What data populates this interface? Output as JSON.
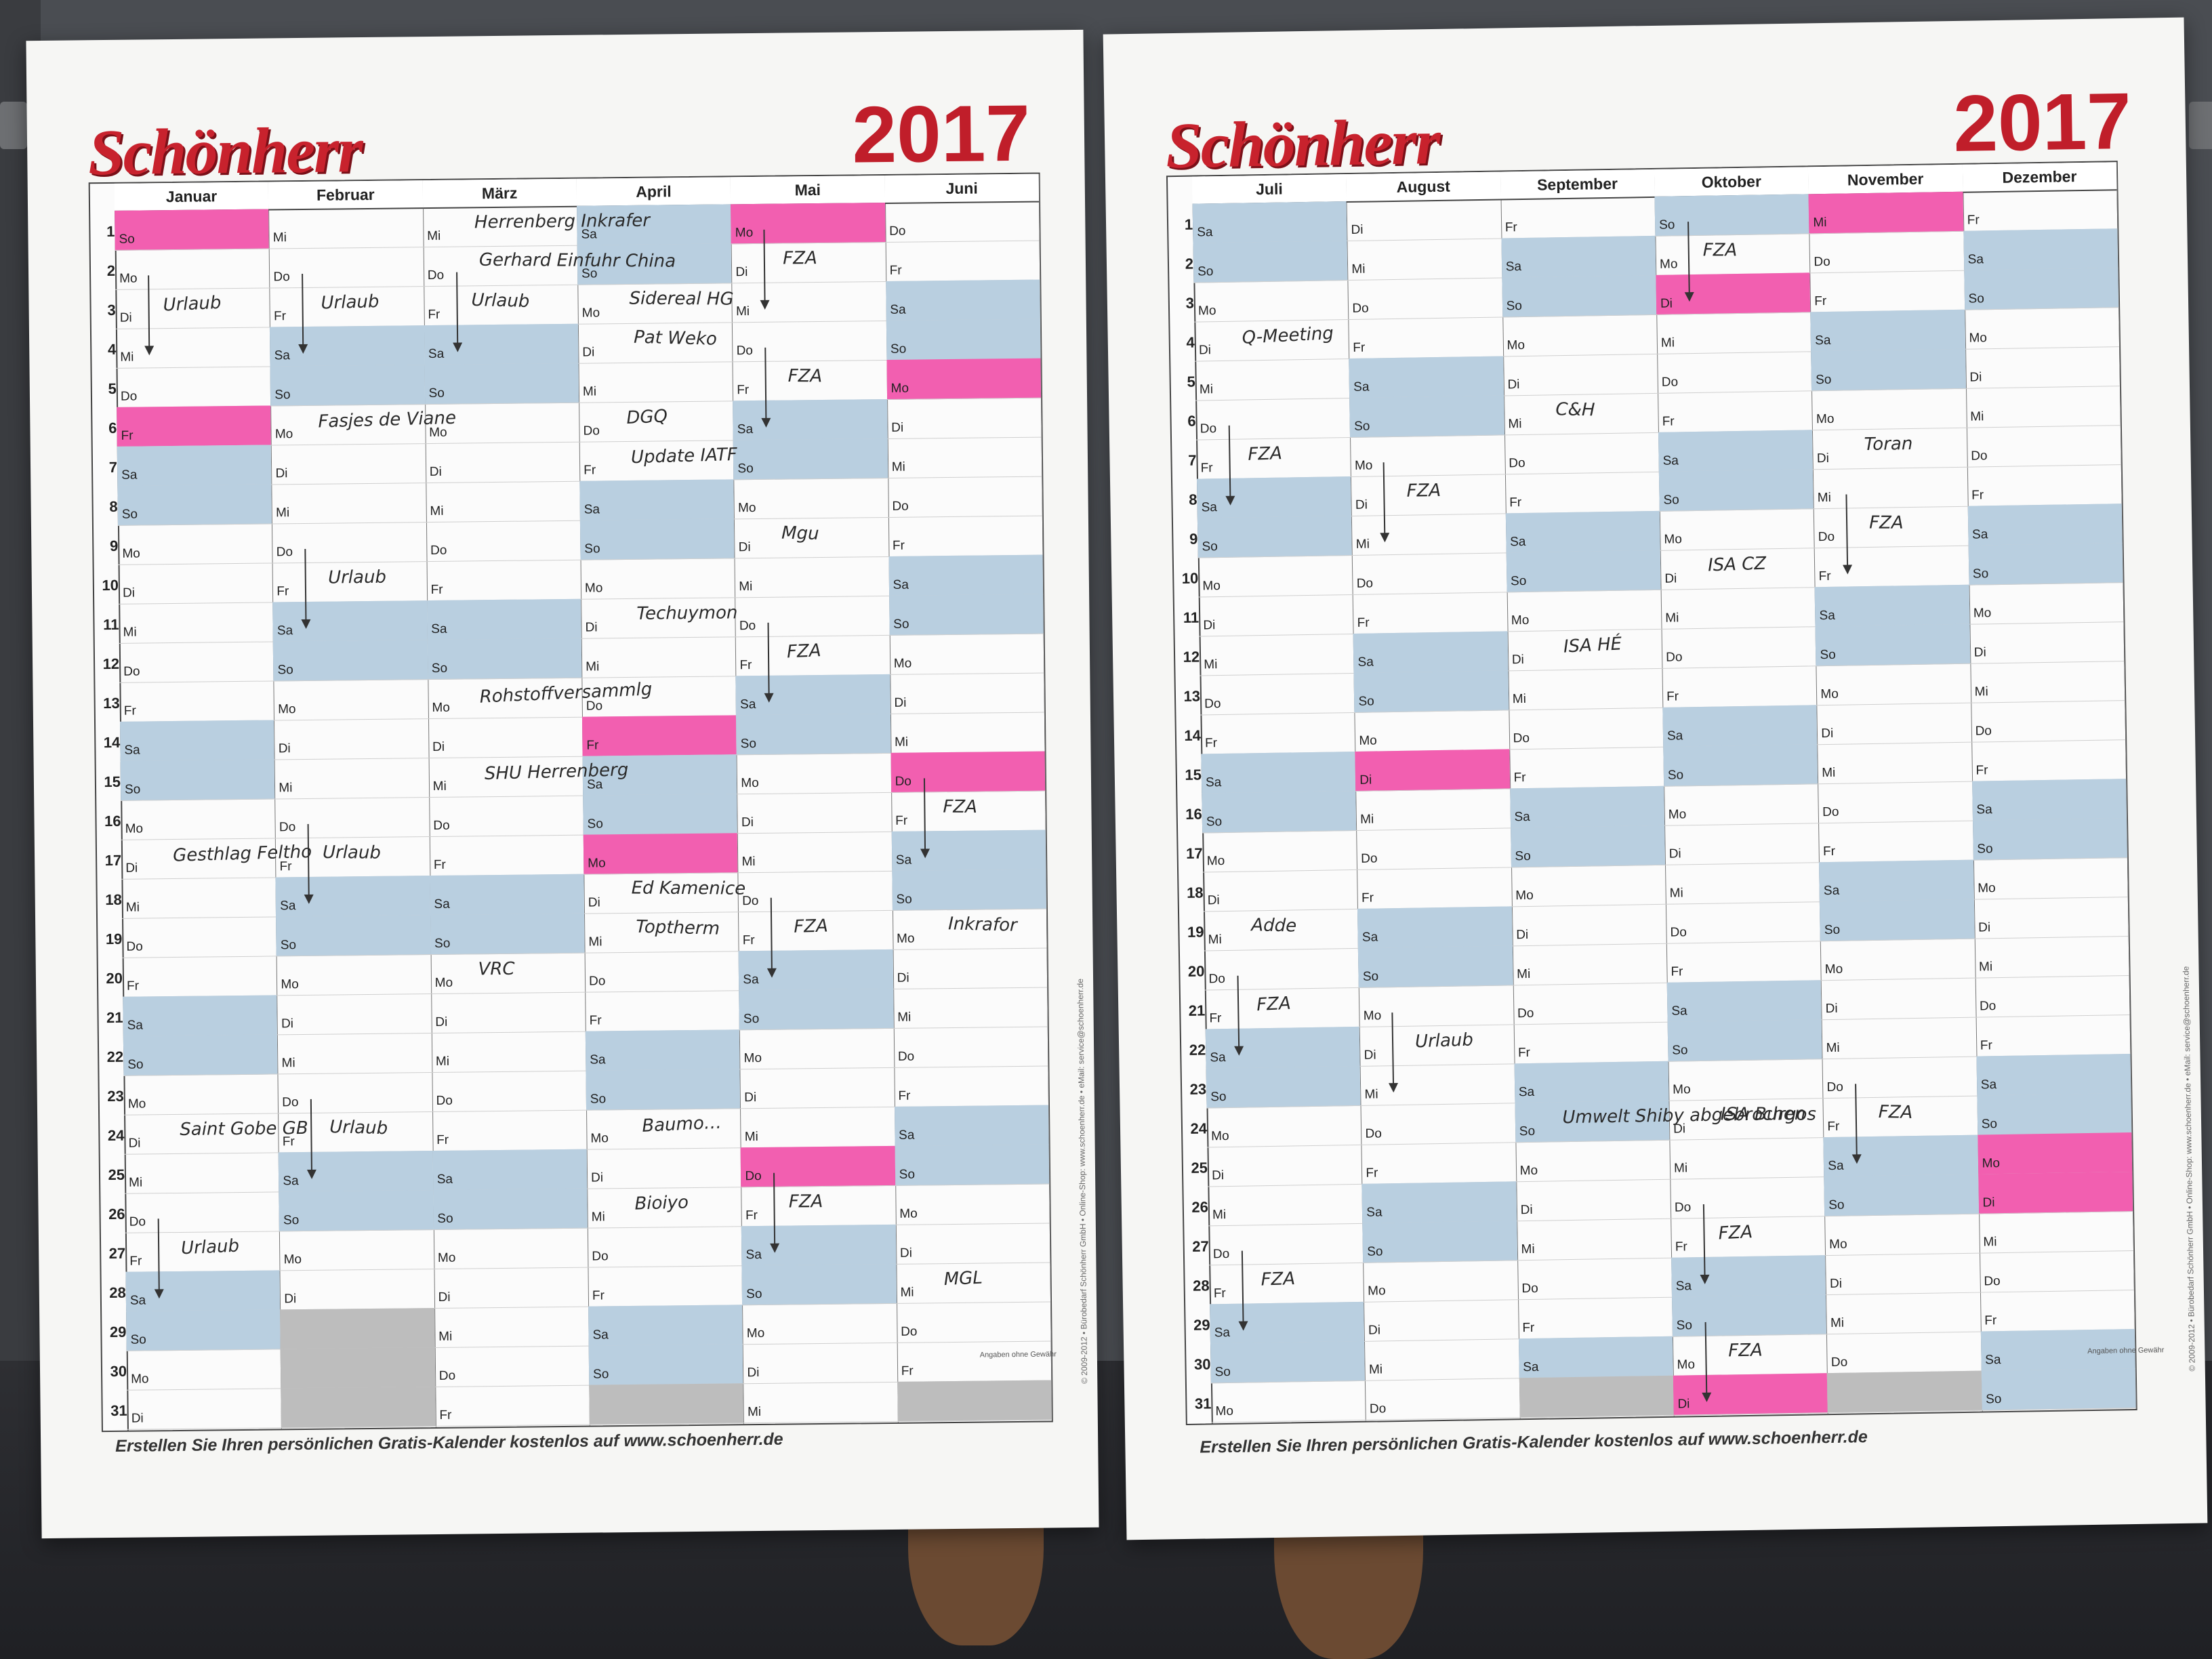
{
  "brand": "Schönherr",
  "year": "2017",
  "footer": "Erstellen Sie Ihren persönlichen Gratis-Kalender kostenlos auf www.schoenherr.de",
  "sideprint": "© 2009-2012 • Bürobedarf Schönherr GmbH • Online-Shop: www.schoenherr.de • eMail: service@schoenherr.de",
  "disclaimer": "Angaben ohne Gewähr",
  "colors": {
    "weekend": "#b9cfe0",
    "holiday": "#f25fb0",
    "brand": "#c8222d"
  },
  "sheets": [
    {
      "months": [
        {
          "name": "Januar",
          "days": 31,
          "start": 6
        },
        {
          "name": "Februar",
          "days": 28,
          "start": 2
        },
        {
          "name": "März",
          "days": 31,
          "start": 2
        },
        {
          "name": "April",
          "days": 30,
          "start": 5
        },
        {
          "name": "Mai",
          "days": 31,
          "start": 0
        },
        {
          "name": "Juni",
          "days": 30,
          "start": 3
        }
      ],
      "holidays": [
        [
          0,
          1
        ],
        [
          0,
          6
        ],
        [
          3,
          14
        ],
        [
          3,
          17
        ],
        [
          4,
          1
        ],
        [
          4,
          25
        ],
        [
          5,
          5
        ],
        [
          5,
          15
        ]
      ],
      "notes": [
        {
          "text": "Urlaub",
          "m": 0,
          "d": 3
        },
        {
          "text": "Urlaub",
          "m": 1,
          "d": 3
        },
        {
          "text": "Urlaub",
          "m": 1,
          "d": 10
        },
        {
          "text": "Urlaub",
          "m": 1,
          "d": 17
        },
        {
          "text": "Urlaub",
          "m": 1,
          "d": 24
        },
        {
          "text": "Urlaub",
          "m": 0,
          "d": 27
        },
        {
          "text": "Fasjes de Viane",
          "m": 1,
          "d": 6
        },
        {
          "text": "Herrenberg Inkrafer",
          "m": 2,
          "d": 1
        },
        {
          "text": "Gerhard Einfuhr China",
          "m": 2,
          "d": 2
        },
        {
          "text": "Urlaub",
          "m": 2,
          "d": 3
        },
        {
          "text": "Rohstoffversammlg",
          "m": 2,
          "d": 13
        },
        {
          "text": "SHU Herrenberg",
          "m": 2,
          "d": 15
        },
        {
          "text": "VRC",
          "m": 2,
          "d": 20
        },
        {
          "text": "Sidereal HG",
          "m": 3,
          "d": 3
        },
        {
          "text": "Pat Weko",
          "m": 3,
          "d": 4
        },
        {
          "text": "DGQ",
          "m": 3,
          "d": 6
        },
        {
          "text": "Update IATF",
          "m": 3,
          "d": 7
        },
        {
          "text": "Techuymon",
          "m": 3,
          "d": 11
        },
        {
          "text": "Ed Kamenice",
          "m": 3,
          "d": 18
        },
        {
          "text": "Toptherm",
          "m": 3,
          "d": 19
        },
        {
          "text": "Baumo…",
          "m": 3,
          "d": 24
        },
        {
          "text": "Bioiyo",
          "m": 3,
          "d": 26
        },
        {
          "text": "FZA",
          "m": 4,
          "d": 2
        },
        {
          "text": "FZA",
          "m": 4,
          "d": 5
        },
        {
          "text": "Mgu",
          "m": 4,
          "d": 9
        },
        {
          "text": "FZA",
          "m": 4,
          "d": 12
        },
        {
          "text": "FZA",
          "m": 4,
          "d": 19
        },
        {
          "text": "FZA",
          "m": 4,
          "d": 26
        },
        {
          "text": "FZA",
          "m": 5,
          "d": 16
        },
        {
          "text": "Inkrafor",
          "m": 5,
          "d": 19
        },
        {
          "text": "MGL",
          "m": 5,
          "d": 28
        },
        {
          "text": "Gesthlag Feltho",
          "m": 0,
          "d": 17
        },
        {
          "text": "Saint Gobe GB",
          "m": 0,
          "d": 24
        }
      ]
    },
    {
      "months": [
        {
          "name": "Juli",
          "days": 31,
          "start": 5
        },
        {
          "name": "August",
          "days": 31,
          "start": 1
        },
        {
          "name": "September",
          "days": 30,
          "start": 4
        },
        {
          "name": "Oktober",
          "days": 31,
          "start": 6
        },
        {
          "name": "November",
          "days": 30,
          "start": 2
        },
        {
          "name": "Dezember",
          "days": 31,
          "start": 4
        }
      ],
      "holidays": [
        [
          1,
          15
        ],
        [
          3,
          3
        ],
        [
          3,
          31
        ],
        [
          4,
          1
        ],
        [
          5,
          25
        ],
        [
          5,
          26
        ]
      ],
      "notes": [
        {
          "text": "Q-Meeting",
          "m": 0,
          "d": 4
        },
        {
          "text": "FZA",
          "m": 0,
          "d": 7
        },
        {
          "text": "FZA",
          "m": 1,
          "d": 8
        },
        {
          "text": "FZA",
          "m": 3,
          "d": 2
        },
        {
          "text": "C&H",
          "m": 2,
          "d": 6
        },
        {
          "text": "ISA HÉ",
          "m": 2,
          "d": 12
        },
        {
          "text": "ISA CZ",
          "m": 3,
          "d": 10
        },
        {
          "text": "Toran",
          "m": 4,
          "d": 7
        },
        {
          "text": "FZA",
          "m": 4,
          "d": 9
        },
        {
          "text": "Adde",
          "m": 0,
          "d": 19
        },
        {
          "text": "FZA",
          "m": 0,
          "d": 21
        },
        {
          "text": "Urlaub",
          "m": 1,
          "d": 22
        },
        {
          "text": "Umwelt Shiby abgebrochen",
          "m": 2,
          "d": 24
        },
        {
          "text": "ISA Burgos",
          "m": 3,
          "d": 24
        },
        {
          "text": "FZA",
          "m": 4,
          "d": 24
        },
        {
          "text": "FZA",
          "m": 3,
          "d": 27
        },
        {
          "text": "FZA",
          "m": 0,
          "d": 28
        },
        {
          "text": "FZA",
          "m": 3,
          "d": 30
        }
      ]
    }
  ]
}
